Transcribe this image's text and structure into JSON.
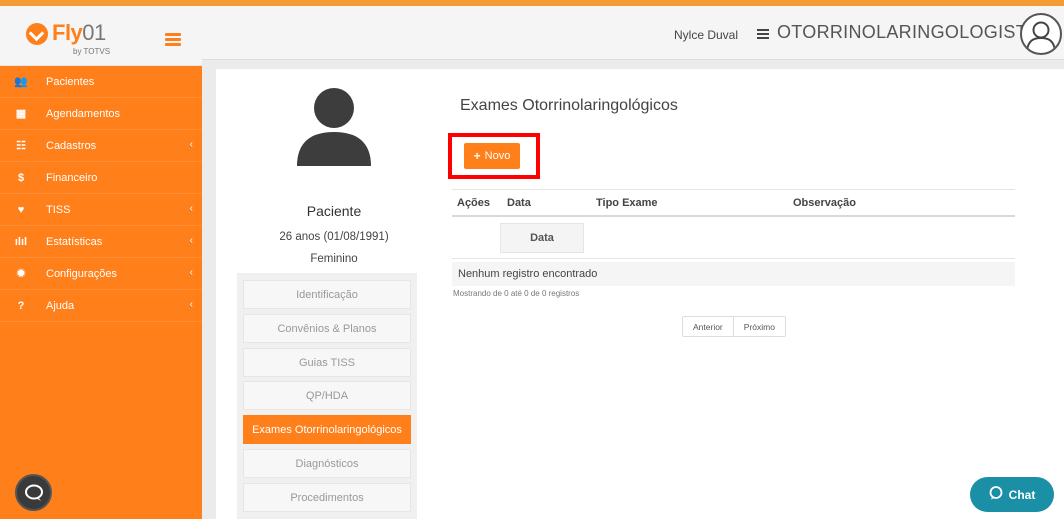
{
  "app": {
    "logo_brand": "Fly",
    "logo_number": "01",
    "logo_byline": "by TOTVS"
  },
  "colors": {
    "brand_orange": "#ff7f1a",
    "highlight_red": "#ff0000",
    "chat_teal": "#1a8fa6"
  },
  "sidebar": {
    "items": [
      {
        "label": "Pacientes",
        "icon": "users-icon",
        "glyph": "👥",
        "has_submenu": false
      },
      {
        "label": "Agendamentos",
        "icon": "calendar-icon",
        "glyph": "▦",
        "has_submenu": false
      },
      {
        "label": "Cadastros",
        "icon": "list-icon",
        "glyph": "☷",
        "has_submenu": true
      },
      {
        "label": "Financeiro",
        "icon": "dollar-icon",
        "glyph": "$",
        "has_submenu": false
      },
      {
        "label": "TISS",
        "icon": "heartbeat-icon",
        "glyph": "♥",
        "has_submenu": true
      },
      {
        "label": "Estatísticas",
        "icon": "bar-chart-icon",
        "glyph": "ılıl",
        "has_submenu": true
      },
      {
        "label": "Configurações",
        "icon": "gear-icon",
        "glyph": "✹",
        "has_submenu": true
      },
      {
        "label": "Ajuda",
        "icon": "question-icon",
        "glyph": "?",
        "has_submenu": true
      }
    ],
    "submenu_chevron": "‹"
  },
  "header": {
    "user_name": "Nylce Duval",
    "role": "OTORRINOLARINGOLOGISTA",
    "role_chevron": "⌄"
  },
  "patient": {
    "title": "Paciente",
    "age": "26 anos (01/08/1991)",
    "sex": "Feminino"
  },
  "patient_tabs": [
    {
      "label": "Identificação",
      "active": false
    },
    {
      "label": "Convênios & Planos",
      "active": false
    },
    {
      "label": "Guias TISS",
      "active": false
    },
    {
      "label": "QP/HDA",
      "active": false
    },
    {
      "label": "Exames Otorrinolaringológicos",
      "active": true
    },
    {
      "label": "Diagnósticos",
      "active": false
    },
    {
      "label": "Procedimentos",
      "active": false
    }
  ],
  "main": {
    "title": "Exames Otorrinolaringológicos",
    "new_button": {
      "plus": "+",
      "label": "Novo"
    },
    "columns": [
      "Ações",
      "Data",
      "Tipo Exame",
      "Observação"
    ],
    "filter_label": "Data",
    "empty_message": "Nenhum registro encontrado",
    "records_info": "Mostrando de 0 até 0 de 0 registros",
    "pager": {
      "previous": "Anterior",
      "next": "Próximo"
    }
  },
  "chat": {
    "label": "Chat"
  }
}
